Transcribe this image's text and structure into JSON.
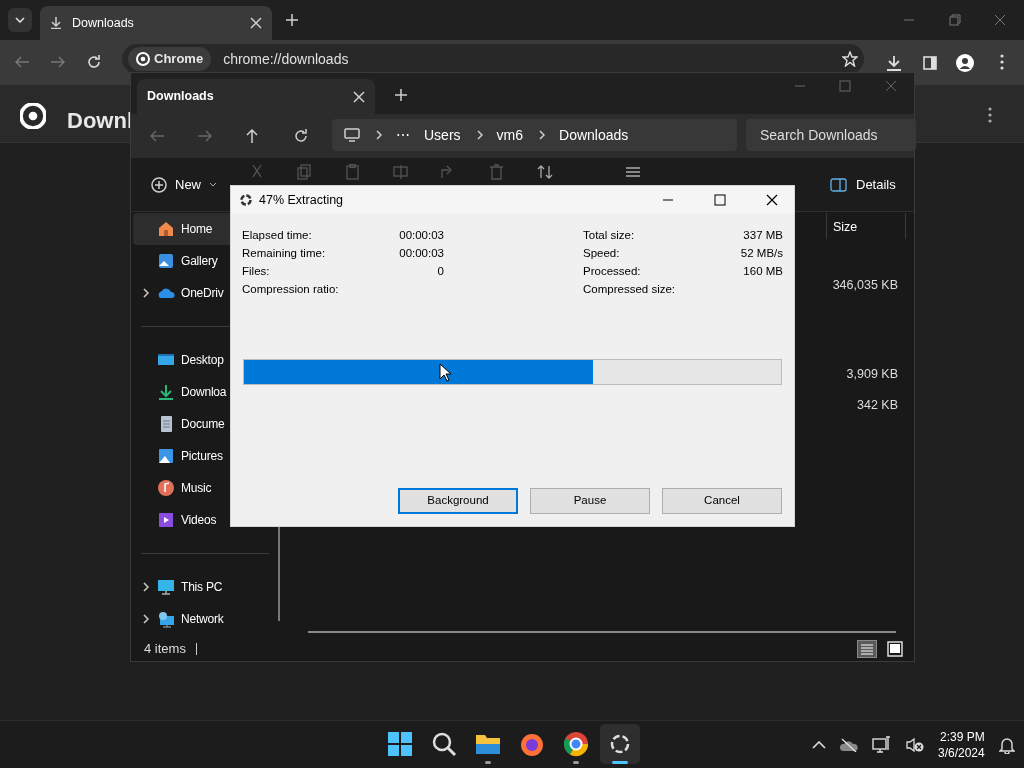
{
  "browser": {
    "tab_title": "Downloads",
    "site_chip": "Chrome",
    "url": "chrome://downloads",
    "page_title": "Downl"
  },
  "explorer": {
    "tab_title": "Downloads",
    "breadcrumb_more": "⋯",
    "breadcrumb": [
      "Users",
      "vm6",
      "Downloads"
    ],
    "search_placeholder": "Search Downloads",
    "new_label": "New",
    "details_label": "Details",
    "size_header": "Size",
    "sizes": [
      "346,035 KB",
      "3,909 KB",
      "342 KB"
    ],
    "sidebar_groups": [
      [
        {
          "label": "Home",
          "kind": "home",
          "expandable": false,
          "selected": true
        },
        {
          "label": "Gallery",
          "kind": "gallery",
          "expandable": false,
          "selected": false
        },
        {
          "label": "OneDriv",
          "kind": "cloud",
          "expandable": true,
          "selected": false
        }
      ],
      [
        {
          "label": "Desktop",
          "kind": "desktop",
          "expandable": false,
          "selected": false
        },
        {
          "label": "Downloa",
          "kind": "download",
          "expandable": false,
          "selected": false
        },
        {
          "label": "Docume",
          "kind": "document",
          "expandable": false,
          "selected": false
        },
        {
          "label": "Pictures",
          "kind": "pictures",
          "expandable": false,
          "selected": false
        },
        {
          "label": "Music",
          "kind": "music",
          "expandable": false,
          "selected": false
        },
        {
          "label": "Videos",
          "kind": "videos",
          "expandable": false,
          "selected": false
        }
      ],
      [
        {
          "label": "This PC",
          "kind": "pc",
          "expandable": true,
          "selected": false
        },
        {
          "label": "Network",
          "kind": "network",
          "expandable": true,
          "selected": false
        }
      ]
    ],
    "status": "4 items"
  },
  "dialog": {
    "title": "47% Extracting",
    "stats_left": [
      {
        "label": "Elapsed time:",
        "value": "00:00:03"
      },
      {
        "label": "Remaining time:",
        "value": "00:00:03"
      },
      {
        "label": "Files:",
        "value": "0"
      },
      {
        "label": "Compression ratio:"
      }
    ],
    "stats_right": [
      {
        "label": "Total size:",
        "value": "337 MB"
      },
      {
        "label": "Speed:",
        "value": "52 MB/s"
      },
      {
        "label": "Processed:",
        "value": "160 MB"
      },
      {
        "label": "Compressed size:"
      }
    ],
    "progress": {
      "level": 0.65
    },
    "buttons": [
      "Background",
      "Pause",
      "Cancel"
    ]
  },
  "taskbar": {
    "apps": [
      {
        "kind": "start",
        "running": false,
        "active": false
      },
      {
        "kind": "search",
        "running": false,
        "active": false
      },
      {
        "kind": "folder",
        "running": true,
        "active": false
      },
      {
        "kind": "firefox",
        "running": false,
        "active": false
      },
      {
        "kind": "chrome",
        "running": true,
        "active": false
      },
      {
        "kind": "spinner",
        "running": true,
        "active": true
      }
    ],
    "time": "2:39 PM",
    "date": "3/6/2024"
  }
}
